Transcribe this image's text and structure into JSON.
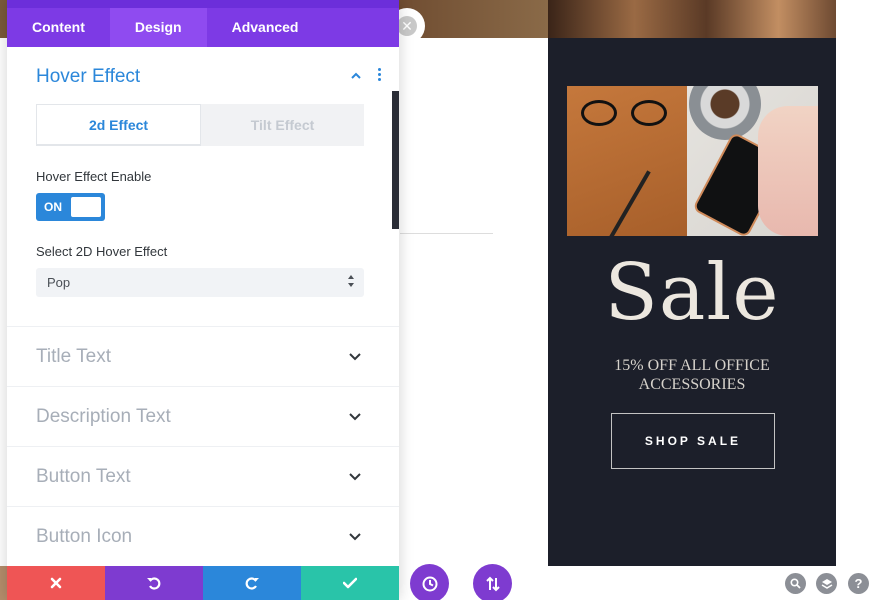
{
  "colors": {
    "purple": "#7d3ae5",
    "accent_blue": "#2b87da",
    "discard_red": "#ef5555",
    "save_green": "#29c4a9",
    "promo_bg": "#1c1f2a"
  },
  "panel": {
    "tabs": [
      {
        "label": "Content",
        "active": false
      },
      {
        "label": "Design",
        "active": true
      },
      {
        "label": "Advanced",
        "active": false
      }
    ],
    "hover_effect": {
      "title": "Hover Effect",
      "effect_tabs": [
        {
          "label": "2d Effect",
          "active": true
        },
        {
          "label": "Tilt Effect",
          "active": false
        }
      ],
      "enable_label": "Hover Effect Enable",
      "toggle_state": "ON",
      "select_label": "Select 2D Hover Effect",
      "select_value": "Pop"
    },
    "sections": [
      {
        "label": "Title Text"
      },
      {
        "label": "Description Text"
      },
      {
        "label": "Button Text"
      },
      {
        "label": "Button Icon"
      }
    ]
  },
  "footer": {
    "buttons": [
      {
        "icon": "close-icon",
        "color": "#ef5555"
      },
      {
        "icon": "undo-icon",
        "color": "#7e3bd0"
      },
      {
        "icon": "redo-icon",
        "color": "#2b87da"
      },
      {
        "icon": "check-icon",
        "color": "#29c4a9"
      }
    ]
  },
  "floating": {
    "history_icon": "clock-icon",
    "portability_icon": "sort-arrows-icon",
    "zoom_icon": "search-icon",
    "layers_icon": "layers-icon",
    "help_label": "?"
  },
  "promo": {
    "title": "Sale",
    "subtitle": "15% OFF ALL OFFICE ACCESSORIES",
    "button_label": "SHOP SALE"
  }
}
